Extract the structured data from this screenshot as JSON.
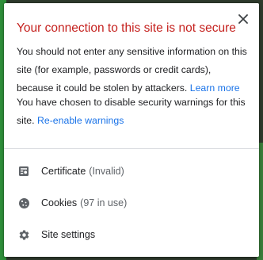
{
  "popup": {
    "title": "Your connection to this site is not secure",
    "warning_text": "You should not enter any sensitive information on this site (for example, passwords or credit cards), because it could be stolen by attackers.",
    "learn_more_link": "Learn more",
    "disabled_text": "You have chosen to disable security warnings for this site.",
    "reenable_link": "Re-enable warnings",
    "close_icon": "close-icon"
  },
  "menu": {
    "items": [
      {
        "label": "Certificate",
        "status": "(Invalid)",
        "icon": "certificate-icon"
      },
      {
        "label": "Cookies",
        "status": "(97 in use)",
        "icon": "cookie-icon"
      },
      {
        "label": "Site settings",
        "icon": "gear-icon"
      }
    ]
  },
  "colors": {
    "title": "#c5221f",
    "link": "#1a73e8",
    "text": "#202124",
    "secondary_text": "#5f6368",
    "icon": "#5f6368"
  }
}
